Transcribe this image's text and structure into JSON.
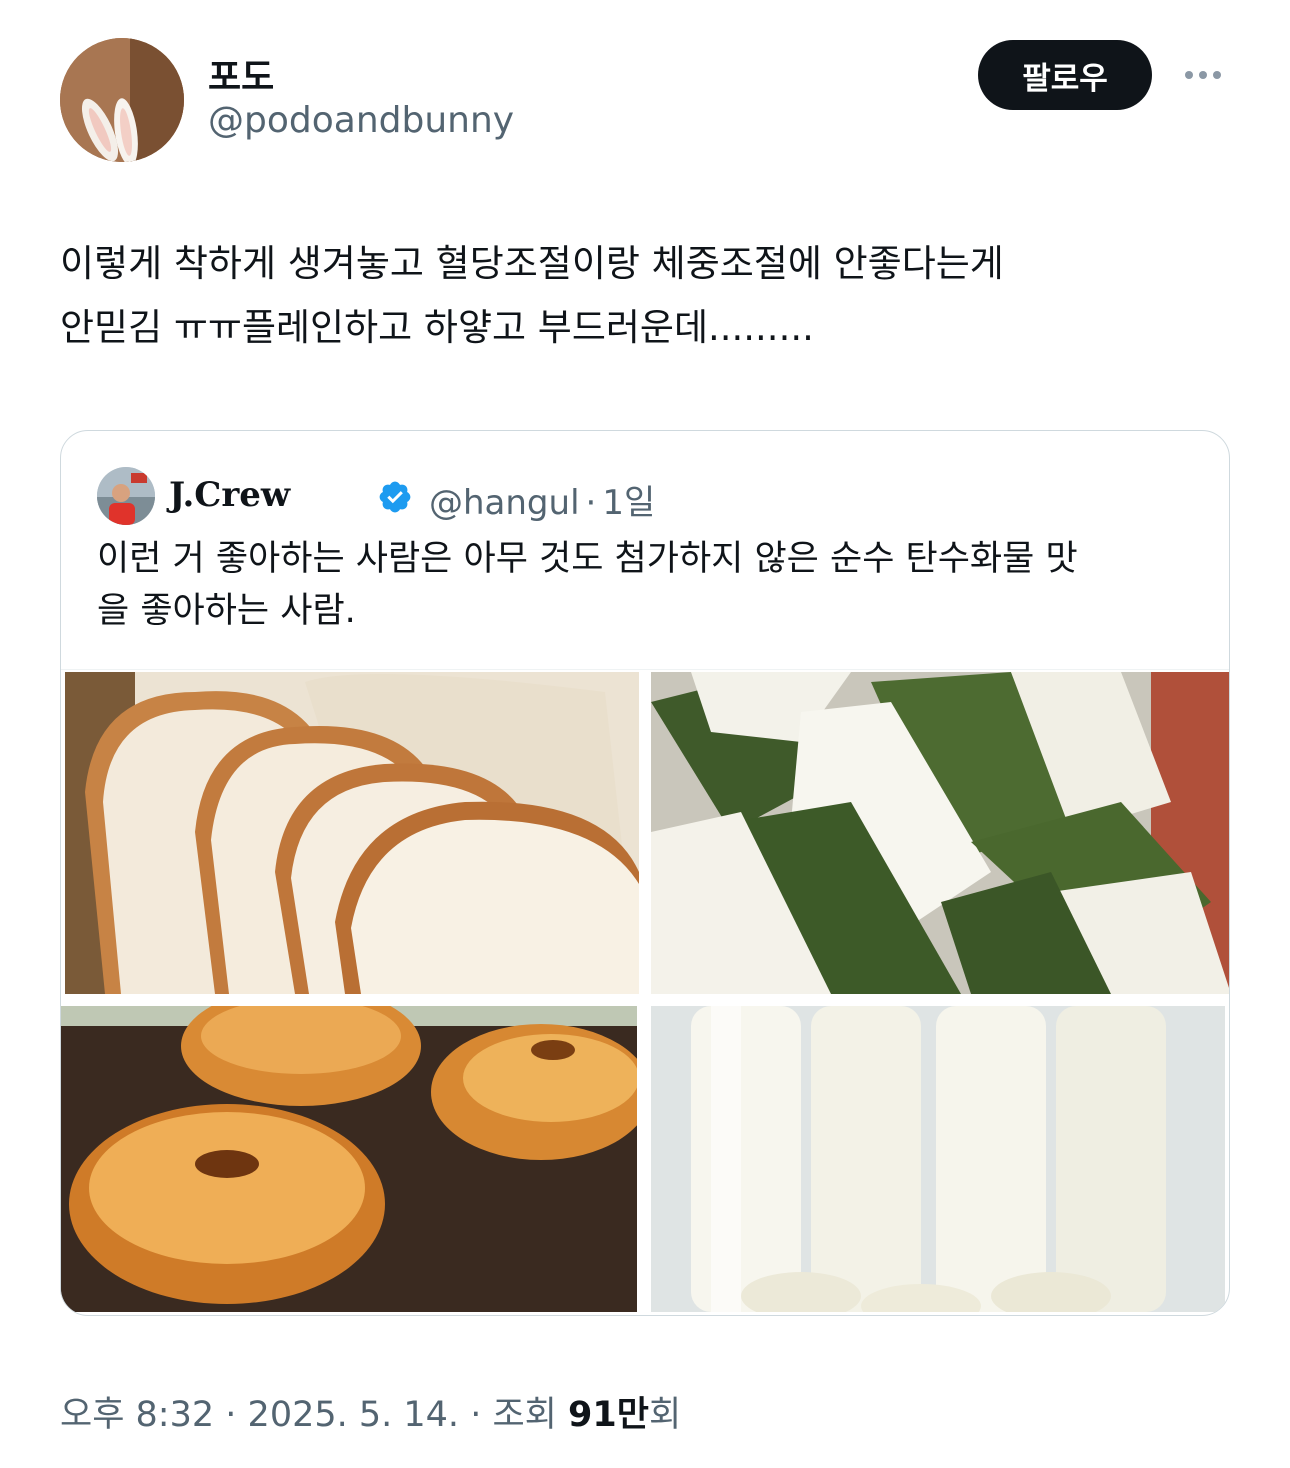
{
  "author": {
    "display_name": "포도",
    "handle": "@podoandbunny"
  },
  "follow_label": "팔로우",
  "tweet": {
    "lines": [
      "이렇게 착하게 생겨놓고 혈당조절이랑 체중조절에 안좋다는게",
      "안믿김 ㅠㅠ플레인하고 하얗고 부드러운데........."
    ]
  },
  "quote": {
    "name": "J.Crew",
    "handle": "@hangul",
    "separator": "·",
    "time": "1일",
    "lines": [
      "이런 거 좋아하는 사람은 아무 것도 첨가하지 않은 순수 탄수화물 맛",
      "을 좋아하는 사람."
    ],
    "verified_color": "#1d9bf0"
  },
  "footer": {
    "time": "오후 8:32",
    "sep1": "·",
    "date": "2025. 5. 14.",
    "sep2": "·",
    "views_label": "조회",
    "views_count": "91만",
    "views_suffix": "회"
  }
}
